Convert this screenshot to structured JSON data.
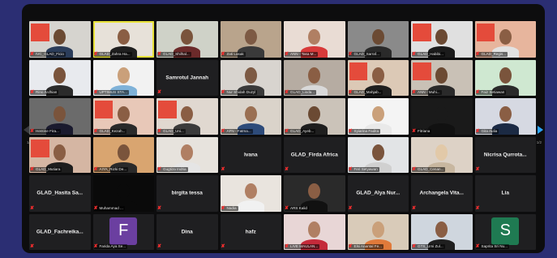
{
  "colors": {
    "frame": "#0d0d0e",
    "background": "#2b2e73",
    "active_border": "#e8e23a",
    "muted": "#ff2e2e",
    "nav": "#2ea6ff"
  },
  "pagination": {
    "left": "1/2",
    "right": "1/2"
  },
  "tiles": [
    {
      "label": "IVC_GLAD_Ficio",
      "kind": "video",
      "bg": "#d6d4cf",
      "skin": "#6b4a33",
      "shirt": "#2b3d5a",
      "banner": true
    },
    {
      "label": "GLAD_Zahra Ha...",
      "kind": "video",
      "bg": "#e7e1d9",
      "skin": "#8a5e44",
      "shirt": "#1f1f1f",
      "active": true
    },
    {
      "label": "GLAD_Shilhal...",
      "kind": "video",
      "bg": "#cfd2c8",
      "skin": "#7a543c",
      "shirt": "#6b2a2a"
    },
    {
      "label": "Zati Lasak",
      "kind": "video",
      "bg": "#b9a48c",
      "skin": "#7d5a44",
      "shirt": "#3a3a3a"
    },
    {
      "label": "ANN - Tasa M...",
      "kind": "video",
      "bg": "#e9dcd4",
      "skin": "#b07f63",
      "shirt": "#d83a3a"
    },
    {
      "label": "GLAD_Sarraf...",
      "kind": "video",
      "bg": "#8a8a8a",
      "skin": "#6b4a33",
      "shirt": "#2a2a2a"
    },
    {
      "label": "GLAD_Habibi...",
      "kind": "video",
      "bg": "#e0e0e0",
      "skin": "#6b4a33",
      "shirt": "#1b1b1b",
      "banner": true
    },
    {
      "label": "GLAD_Regis...",
      "kind": "video",
      "bg": "#e7b59d",
      "skin": "#8a5e44",
      "shirt": "#e2e2e2",
      "banner": true
    },
    {
      "label": "Rino Ardhian",
      "kind": "video",
      "bg": "#e8eaee",
      "skin": "#7a543c",
      "shirt": "#2b2b2b"
    },
    {
      "label": "UPTIMUS STA...",
      "kind": "video",
      "bg": "#f2f2f2",
      "skin": "#caa07a",
      "shirt": "#7fb2d8"
    },
    {
      "label": "",
      "kind": "name",
      "name": "Samrotul Jannah"
    },
    {
      "label": "Nur Shidah Duzyl",
      "kind": "video",
      "bg": "#d8d4cf",
      "skin": "#7d5a44",
      "shirt": "#3a3a3a"
    },
    {
      "label": "GLAD_Lioda...",
      "kind": "video",
      "bg": "#b6aca2",
      "skin": "#8a5e44",
      "shirt": "#d9d9d9"
    },
    {
      "label": "GLAD_Mahjab...",
      "kind": "video",
      "bg": "#dcc9b6",
      "skin": "#8a5e44",
      "shirt": "#1f1f1f",
      "banner": true
    },
    {
      "label": "ANN - Muhi...",
      "kind": "video",
      "bg": "#c9c1b6",
      "skin": "#6b4a33",
      "shirt": "#2a2a2a",
      "banner": true
    },
    {
      "label": "Faiz Setiawan",
      "kind": "video",
      "bg": "#cfe8d1",
      "skin": "#7a543c",
      "shirt": "#2a2a2a"
    },
    {
      "label": "Hentine Fira...",
      "kind": "video",
      "bg": "#6b6b6b",
      "skin": "#7a543c",
      "shirt": "#1a1a2e"
    },
    {
      "label": "GLAD_Kezah...",
      "kind": "video",
      "bg": "#e8c8b8",
      "skin": "#8a5e44",
      "shirt": "#2a2a2a",
      "banner": true
    },
    {
      "label": "GLAD_Uni...",
      "kind": "video",
      "bg": "#e0d8d0",
      "skin": "#8a5e44",
      "shirt": "#3b3b3b",
      "banner": true
    },
    {
      "label": "AFN - Fatma...",
      "kind": "video",
      "bg": "#dad3ca",
      "skin": "#9a6f52",
      "shirt": "#2d4b7a"
    },
    {
      "label": "GLAD_Ayeb...",
      "kind": "video",
      "bg": "#cbc3b9",
      "skin": "#6b4a33",
      "shirt": "#1e1e1e"
    },
    {
      "label": "Syiarina Fadita",
      "kind": "video",
      "bg": "#f4f4f4",
      "skin": "#caa07a",
      "shirt": "#e9e9e9"
    },
    {
      "label": "Fitriana",
      "kind": "video",
      "bg": "#1a1a1a",
      "skin": "#1a1a1a",
      "shirt": "#111111"
    },
    {
      "label": "Gita Aulia",
      "kind": "video",
      "bg": "#d6d9e2",
      "skin": "#8a5e44",
      "shirt": "#1b2a44"
    },
    {
      "label": "GLAD_Mutiara",
      "kind": "video",
      "bg": "#d5b6a3",
      "skin": "#8a5e44",
      "shirt": "#1d1d1d",
      "banner": true
    },
    {
      "label": "AIYA_Rizki De...",
      "kind": "video",
      "bg": "#d9a570",
      "skin": "#7a543c",
      "shirt": "#2a2a2a"
    },
    {
      "label": "Gugtiza Indria",
      "kind": "video",
      "bg": "#e7e3dd",
      "skin": "#b07f63",
      "shirt": "#e5e5e5"
    },
    {
      "label": "",
      "kind": "name",
      "name": "Ivana"
    },
    {
      "label": "",
      "kind": "name",
      "name": "GLAD_Firda Africa"
    },
    {
      "label": "Feri Setyawan",
      "kind": "video",
      "bg": "#e2e4e6",
      "skin": "#7a543c",
      "shirt": "#d0d0d0"
    },
    {
      "label": "GLAD_Cenan...",
      "kind": "video",
      "bg": "#ddd2c6",
      "skin": "#e2c9a8",
      "shirt": "#c8b7a0"
    },
    {
      "label": "",
      "kind": "name",
      "name": "Nicrisa Qurrota..."
    },
    {
      "label": "",
      "kind": "name",
      "name": "GLAD_Hasita Sa..."
    },
    {
      "label": "Muhammad ...",
      "kind": "video",
      "bg": "#0a0a0a",
      "skin": "#0a0a0a",
      "shirt": "#0a0a0a"
    },
    {
      "label": "",
      "kind": "name",
      "name": "birgita tessa"
    },
    {
      "label": "Nadia",
      "kind": "video",
      "bg": "#e9e4de",
      "skin": "#b07f63",
      "shirt": "#f1f1f1"
    },
    {
      "label": "ARS Kalid",
      "kind": "video",
      "bg": "#2a2a2a",
      "skin": "#8a5e44",
      "shirt": "#111111"
    },
    {
      "label": "",
      "kind": "name",
      "name": "GLAD_Alya Nur..."
    },
    {
      "label": "",
      "kind": "name",
      "name": "Archangela Vita..."
    },
    {
      "label": "",
      "kind": "name",
      "name": "Lia"
    },
    {
      "label": "",
      "kind": "name",
      "name": "GLAD_Fachreika..."
    },
    {
      "label": "Farida Aya Se...",
      "kind": "letter",
      "letter": "F",
      "avatar_bg": "#6b3fa0"
    },
    {
      "label": "",
      "kind": "name",
      "name": "Dina"
    },
    {
      "label": "",
      "kind": "name",
      "name": "hafz"
    },
    {
      "label": "LIVE MAULAN...",
      "kind": "video",
      "bg": "#e8d6d6",
      "skin": "#b07f63",
      "shirt": "#c42a3a"
    },
    {
      "label": "Elsi Anantal Fe...",
      "kind": "video",
      "bg": "#d9cbb9",
      "skin": "#caa07a",
      "shirt": "#e07a3a"
    },
    {
      "label": "GTS_Umi Zul...",
      "kind": "video",
      "bg": "#cfd6de",
      "skin": "#8a5e44",
      "shirt": "#1f1f1f"
    },
    {
      "label": "Saprita Sri Nu...",
      "kind": "letter",
      "letter": "S",
      "avatar_bg": "#1f7a52"
    }
  ]
}
